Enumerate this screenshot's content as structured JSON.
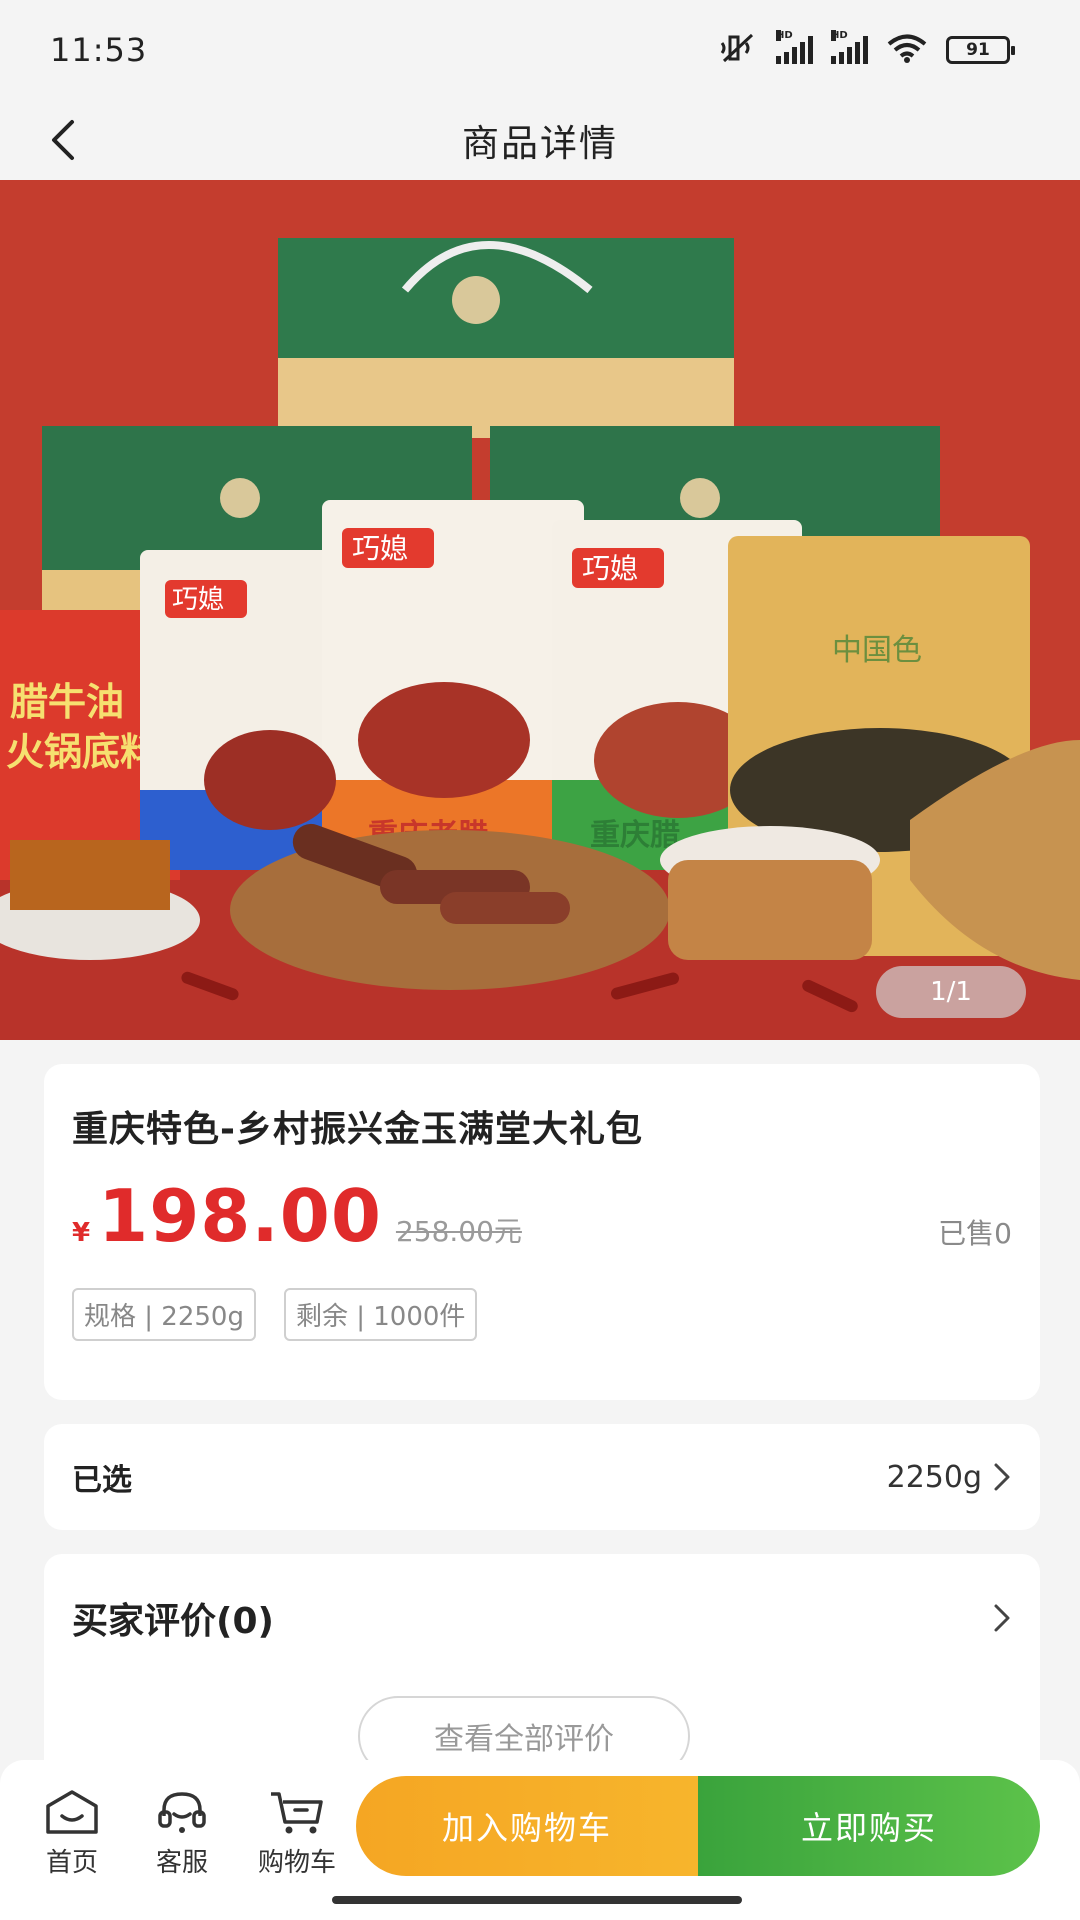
{
  "status_bar": {
    "time": "11:53",
    "battery": "91",
    "signal_label": "HD",
    "icons": [
      "mute-icon",
      "signal-icon",
      "signal-icon",
      "wifi-icon",
      "battery-icon"
    ]
  },
  "header": {
    "title": "商品详情",
    "back_icon": "chevron-left-icon"
  },
  "hero": {
    "pager": "1/1",
    "brand_text": "巧媳",
    "side_text": "中国色",
    "package_text_1": "腊牛油",
    "package_text_2": "火锅底料",
    "package_text_3": "重庆老腊",
    "package_text_4": "重庆腊"
  },
  "product": {
    "name": "重庆特色-乡村振兴金玉满堂大礼包",
    "currency": "¥",
    "price": "198.00",
    "original_price": "258.00元",
    "sold": "已售0",
    "tags": [
      "规格 | 2250g",
      "剩余 | 1000件"
    ]
  },
  "selection": {
    "label": "已选",
    "value": "2250g"
  },
  "reviews": {
    "title": "买家评价(0)",
    "view_all": "查看全部评价"
  },
  "bottom_nav": {
    "home": "首页",
    "service": "客服",
    "cart": "购物车",
    "add_to_cart": "加入购物车",
    "buy_now": "立即购买"
  },
  "colors": {
    "price": "#e02b2b",
    "cart_button": "#f5a623",
    "buy_button": "#3aa33c",
    "hero_background": "#c13c2d"
  }
}
